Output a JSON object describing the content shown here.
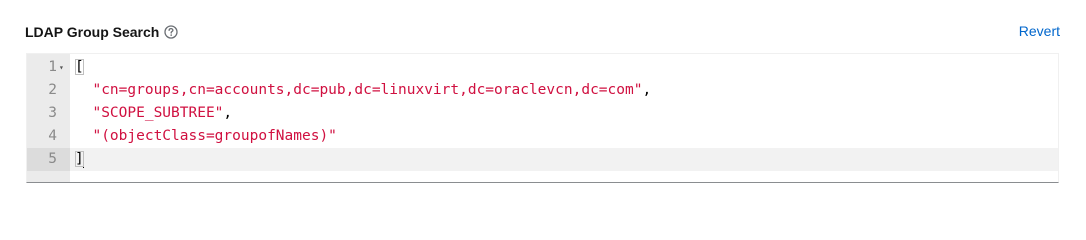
{
  "field": {
    "label": "LDAP Group Search",
    "help_icon": "help-circle-icon",
    "revert_label": "Revert"
  },
  "editor": {
    "fold_icon": "fold-chevron-icon",
    "lines": [
      {
        "number": "1",
        "tokens": [
          {
            "type": "punct",
            "text": "["
          }
        ]
      },
      {
        "number": "2",
        "tokens": [
          {
            "type": "punct",
            "text": "  "
          },
          {
            "type": "str",
            "text": "\"cn=groups,cn=accounts,dc=pub,dc=linuxvirt,dc=oraclevcn,dc=com\""
          },
          {
            "type": "punct",
            "text": ","
          }
        ]
      },
      {
        "number": "3",
        "tokens": [
          {
            "type": "punct",
            "text": "  "
          },
          {
            "type": "str",
            "text": "\"SCOPE_SUBTREE\""
          },
          {
            "type": "punct",
            "text": ","
          }
        ]
      },
      {
        "number": "4",
        "tokens": [
          {
            "type": "punct",
            "text": "  "
          },
          {
            "type": "str",
            "text": "\"(objectClass=groupofNames)\""
          }
        ]
      },
      {
        "number": "5",
        "tokens": [
          {
            "type": "punct",
            "text": "]"
          }
        ]
      }
    ]
  },
  "colors": {
    "link": "#0066cc",
    "string": "#d01040",
    "label": "#151515"
  }
}
